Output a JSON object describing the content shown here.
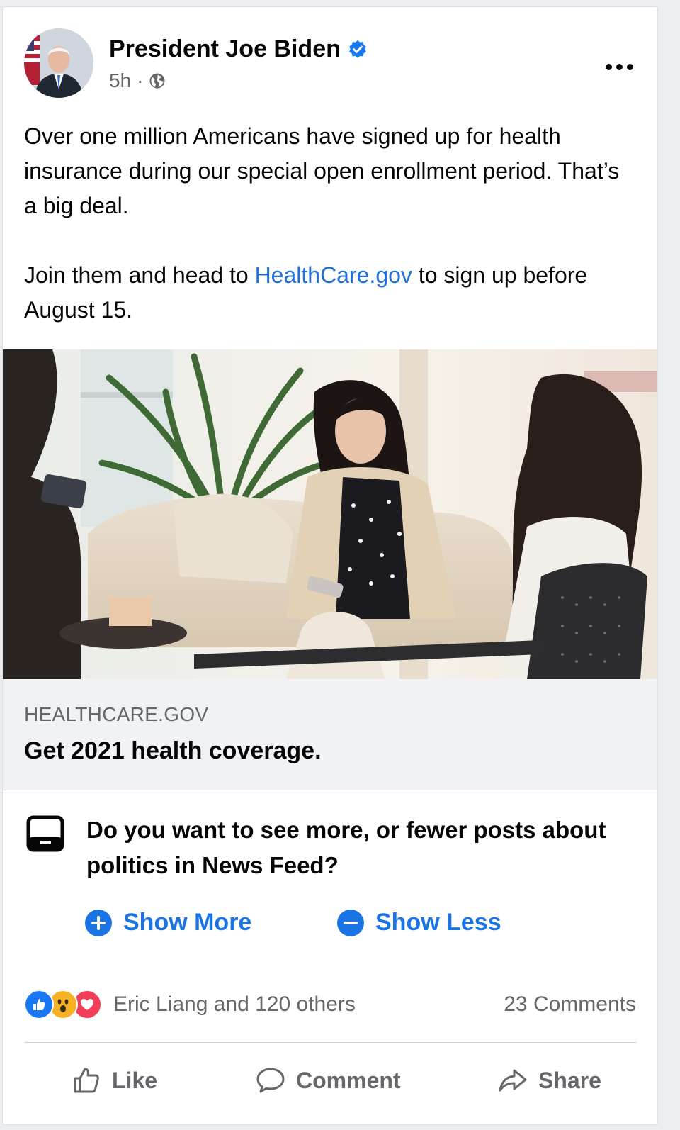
{
  "post": {
    "author": "President Joe Biden",
    "time": "5h",
    "separator": "·",
    "text_line1": "Over one million Americans have signed up for health insurance during our special open enrollment period. That’s a big deal.",
    "text_p2_before": "Join them and head to ",
    "text_p2_link": "HealthCare.gov",
    "text_p2_after": " to sign up before August 15."
  },
  "link_preview": {
    "domain": "HEALTHCARE.GOV",
    "title": "Get 2021 health coverage."
  },
  "politics_prompt": {
    "question": "Do you want to see more, or fewer posts about politics in News Feed?",
    "show_more": "Show More",
    "show_less": "Show Less"
  },
  "engagement": {
    "reactors": "Eric Liang and 120 others",
    "comments": "23 Comments"
  },
  "actions": {
    "like": "Like",
    "comment": "Comment",
    "share": "Share"
  },
  "colors": {
    "accent": "#1b74e4",
    "link": "#216fdb",
    "secondary_text": "#65676b",
    "preview_bg": "#f0f2f5"
  },
  "icons": [
    "verified-badge-icon",
    "globe-icon",
    "more-options-icon",
    "politics-prompt-icon",
    "plus-circle-icon",
    "minus-circle-icon",
    "like-reaction-icon",
    "wow-reaction-icon",
    "love-reaction-icon",
    "like-icon",
    "comment-icon",
    "share-icon"
  ]
}
